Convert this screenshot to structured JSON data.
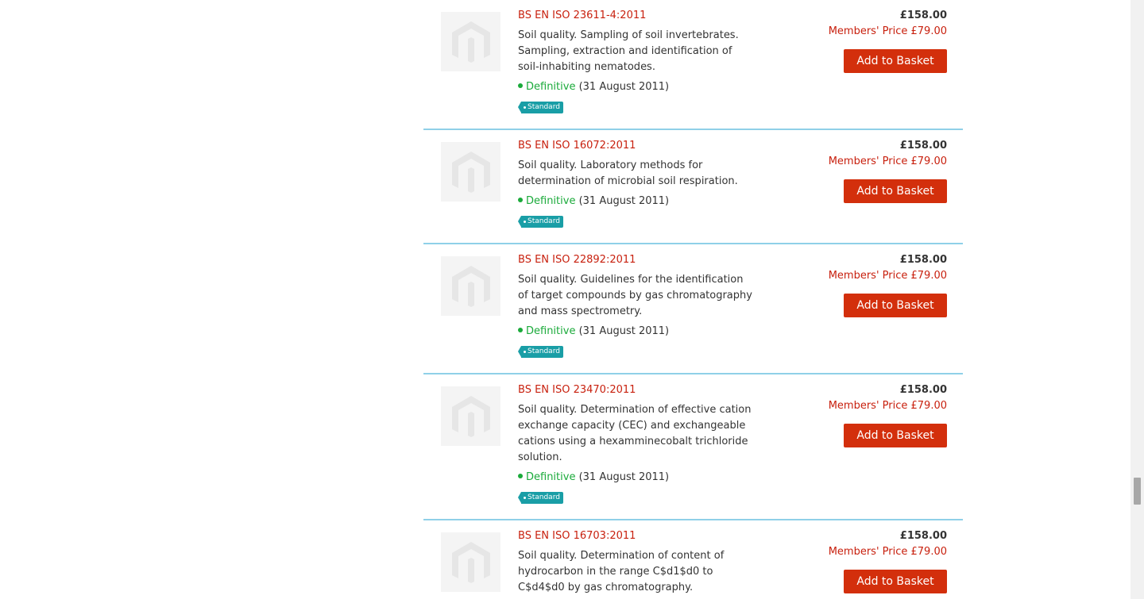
{
  "products": [
    {
      "code": "BS EN ISO 23611-4:2011",
      "title": "Soil quality. Sampling of soil invertebrates. Sampling, extraction and identification of soil-inhabiting nematodes.",
      "status": "Definitive",
      "date": "(31 August 2011)",
      "tag": "Standard",
      "price": "£158.00",
      "members_price": "Members' Price £79.00",
      "button": "Add to Basket"
    },
    {
      "code": "BS EN ISO 16072:2011",
      "title": "Soil quality. Laboratory methods for determination of microbial soil respiration.",
      "status": "Definitive",
      "date": "(31 August 2011)",
      "tag": "Standard",
      "price": "£158.00",
      "members_price": "Members' Price £79.00",
      "button": "Add to Basket"
    },
    {
      "code": "BS EN ISO 22892:2011",
      "title": "Soil quality. Guidelines for the identification of target compounds by gas chromatography and mass spectrometry.",
      "status": "Definitive",
      "date": "(31 August 2011)",
      "tag": "Standard",
      "price": "£158.00",
      "members_price": "Members' Price £79.00",
      "button": "Add to Basket"
    },
    {
      "code": "BS EN ISO 23470:2011",
      "title": "Soil quality. Determination of effective cation exchange capacity (CEC) and exchangeable cations using a hexamminecobalt trichloride solution.",
      "status": "Definitive",
      "date": "(31 August 2011)",
      "tag": "Standard",
      "price": "£158.00",
      "members_price": "Members' Price £79.00",
      "button": "Add to Basket"
    },
    {
      "code": "BS EN ISO 16703:2011",
      "title": "Soil quality. Determination of content of hydrocarbon in the range C$d1$d0 to C$d4$d0 by gas chromatography.",
      "price": "£158.00",
      "members_price": "Members' Price £79.00",
      "button": "Add to Basket"
    }
  ],
  "colors": {
    "link_red": "#c8200e",
    "button_red": "#d32f0c",
    "status_green": "#1aaa3a",
    "tag_teal": "#199ea6",
    "divider_blue": "#8fd0e8"
  }
}
